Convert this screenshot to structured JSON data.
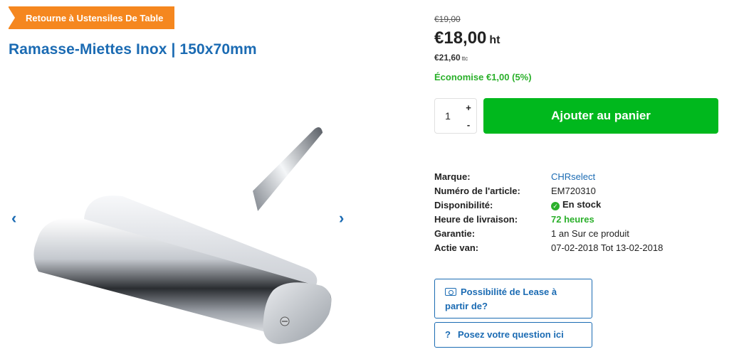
{
  "back_button": {
    "label": "Retourne à Ustensiles De Table"
  },
  "product": {
    "title": "Ramasse-Miettes Inox | 150x70mm"
  },
  "gallery": {
    "prev_icon": "chevron-left-icon",
    "next_icon": "chevron-right-icon"
  },
  "pricing": {
    "old_price": "€19,00",
    "price": "€18,00",
    "price_unit": "ht",
    "price_ttc": "€21,60",
    "price_ttc_unit": "ttc",
    "saving": "Économise €1,00 (5%)"
  },
  "cart": {
    "quantity": "1",
    "plus": "+",
    "minus": "-",
    "add_label": "Ajouter au panier"
  },
  "specs": [
    {
      "label": "Marque:",
      "value": "CHRselect"
    },
    {
      "label": "Numéro de l'article:",
      "value": "EM720310"
    },
    {
      "label": "Disponibilité:",
      "value": "En stock"
    },
    {
      "label": "Heure de livraison:",
      "value": "72 heures"
    },
    {
      "label": "Garantie:",
      "value": "1 an Sur ce produit"
    },
    {
      "label": "Actie van:",
      "value": "07-02-2018 Tot 13-02-2018"
    }
  ],
  "actions": {
    "lease_label": "Possibilité de Lease à partir de?",
    "question_label": "Posez votre question ici"
  },
  "colors": {
    "accent_blue": "#1b6bb3",
    "cart_green": "#00b81d",
    "back_orange": "#f5871f",
    "success_green": "#2bb02b"
  }
}
